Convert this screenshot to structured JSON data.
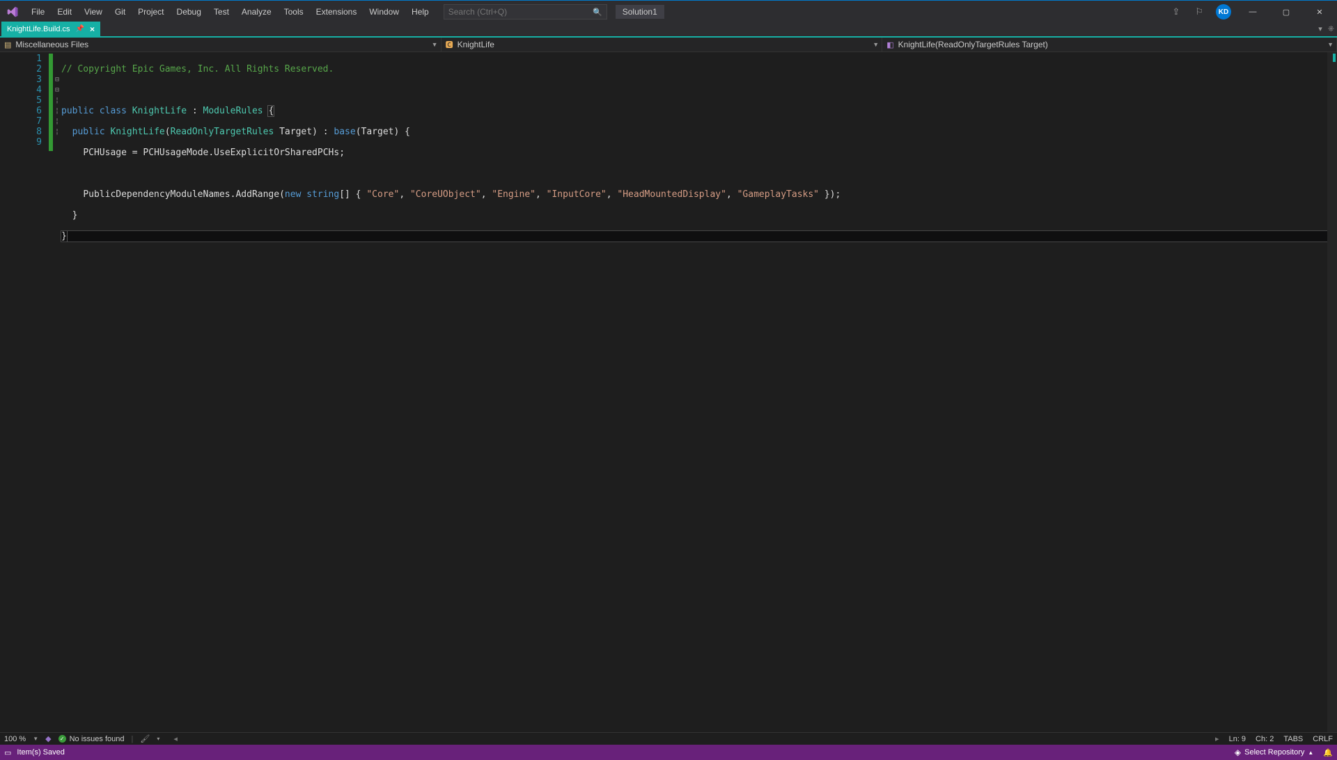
{
  "menu": [
    "File",
    "Edit",
    "View",
    "Git",
    "Project",
    "Debug",
    "Test",
    "Analyze",
    "Tools",
    "Extensions",
    "Window",
    "Help"
  ],
  "search": {
    "placeholder": "Search (Ctrl+Q)"
  },
  "solution_label": "Solution1",
  "avatar_initials": "KD",
  "doc_tab": {
    "title": "KnightLife.Build.cs"
  },
  "nav": {
    "scope": "Miscellaneous Files",
    "class": "KnightLife",
    "member": "KnightLife(ReadOnlyTargetRules Target)"
  },
  "code": {
    "line1_comment": "// Copyright Epic Games, Inc. All Rights Reserved.",
    "kw_public": "public",
    "kw_class": "class",
    "kw_new": "new",
    "kw_string": "string",
    "kw_base": "base",
    "typ_KnightLife": "KnightLife",
    "typ_ModuleRules": "ModuleRules",
    "typ_ReadOnlyTargetRules": "ReadOnlyTargetRules",
    "id_Target": "Target",
    "id_PCHUsage": "PCHUsage",
    "id_PCHUsageMode": "PCHUsageMode",
    "id_UseExplicit": "UseExplicitOrSharedPCHs",
    "id_PubDep": "PublicDependencyModuleNames",
    "id_AddRange": "AddRange",
    "s_Core": "\"Core\"",
    "s_CoreUObject": "\"CoreUObject\"",
    "s_Engine": "\"Engine\"",
    "s_InputCore": "\"InputCore\"",
    "s_HMD": "\"HeadMountedDisplay\"",
    "s_GameplayTasks": "\"GameplayTasks\"",
    "line_numbers": [
      "1",
      "2",
      "3",
      "4",
      "5",
      "6",
      "7",
      "8",
      "9"
    ]
  },
  "editor_footer": {
    "zoom": "100 %",
    "issues": "No issues found",
    "ln": "Ln: 9",
    "ch": "Ch: 2",
    "tabs": "TABS",
    "crlf": "CRLF"
  },
  "status_bar": {
    "message": "Item(s) Saved",
    "repo": "Select Repository"
  }
}
